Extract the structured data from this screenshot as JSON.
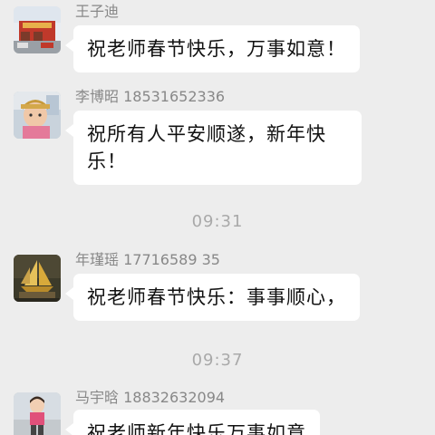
{
  "messages": [
    {
      "sender": "王子迪",
      "text": "祝老师春节快乐，万事如意！",
      "avatar": "building-storefront-photo"
    },
    {
      "sender": "李博昭 18531652336",
      "text_line1": "祝所有人平安顺遂，新年快",
      "text_line2": "乐！",
      "avatar": "child-portrait-photo"
    },
    {
      "sender": "年瑾瑶 17716589 35",
      "text": "祝老师春节快乐：事事顺心，",
      "avatar": "golden-sailboat-photo"
    },
    {
      "sender": "马宇晗 18832632094",
      "text": "祝老师新年快乐万事如意",
      "avatar": "child-outdoor-photo"
    }
  ],
  "timestamps": [
    "09:31",
    "09:37"
  ],
  "colors": {
    "background": "#ededed",
    "bubble": "#ffffff",
    "sender_text": "#888888",
    "time_text": "#a9a9a9"
  }
}
